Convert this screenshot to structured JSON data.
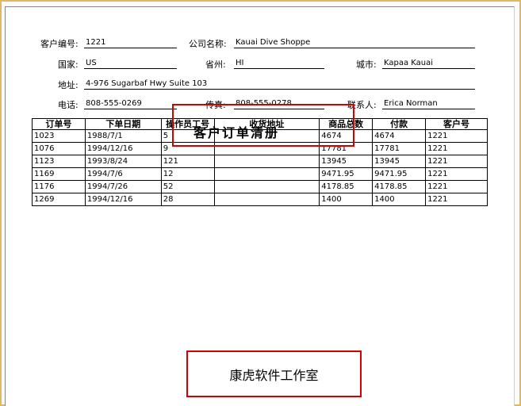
{
  "form": {
    "customer_no_label": "客户编号:",
    "customer_no": "1221",
    "company_label": "公司名称:",
    "company": "Kauai Dive Shoppe",
    "country_label": "国家:",
    "country": "US",
    "state_label": "省州:",
    "state": "HI",
    "city_label": "城市:",
    "city": "Kapaa Kauai",
    "address_label": "地址:",
    "address": "4-976 Sugarbaf Hwy Suite 103",
    "phone_label": "电话:",
    "phone": "808-555-0269",
    "fax_label": "传真:",
    "fax": "808-555-0278",
    "contact_label": "联系人:",
    "contact": "Erica Norman"
  },
  "title": "客户订单清册",
  "table": {
    "headers": [
      "订单号",
      "下单日期",
      "操作员工号",
      "收货地址",
      "商品总数",
      "付款",
      "客户号"
    ],
    "rows": [
      [
        "1023",
        "1988/7/1",
        "5",
        "",
        "4674",
        "4674",
        "1221"
      ],
      [
        "1076",
        "1994/12/16",
        "9",
        "",
        "17781",
        "17781",
        "1221"
      ],
      [
        "1123",
        "1993/8/24",
        "121",
        "",
        "13945",
        "13945",
        "1221"
      ],
      [
        "1169",
        "1994/7/6",
        "12",
        "",
        "9471.95",
        "9471.95",
        "1221"
      ],
      [
        "1176",
        "1994/7/26",
        "52",
        "",
        "4178.85",
        "4178.85",
        "1221"
      ],
      [
        "1269",
        "1994/12/16",
        "28",
        "",
        "1400",
        "1400",
        "1221"
      ]
    ]
  },
  "footer": {
    "studio": "康虎软件工作室"
  },
  "colors": {
    "frame": "#e2b95a",
    "highlight": "#d40000"
  }
}
